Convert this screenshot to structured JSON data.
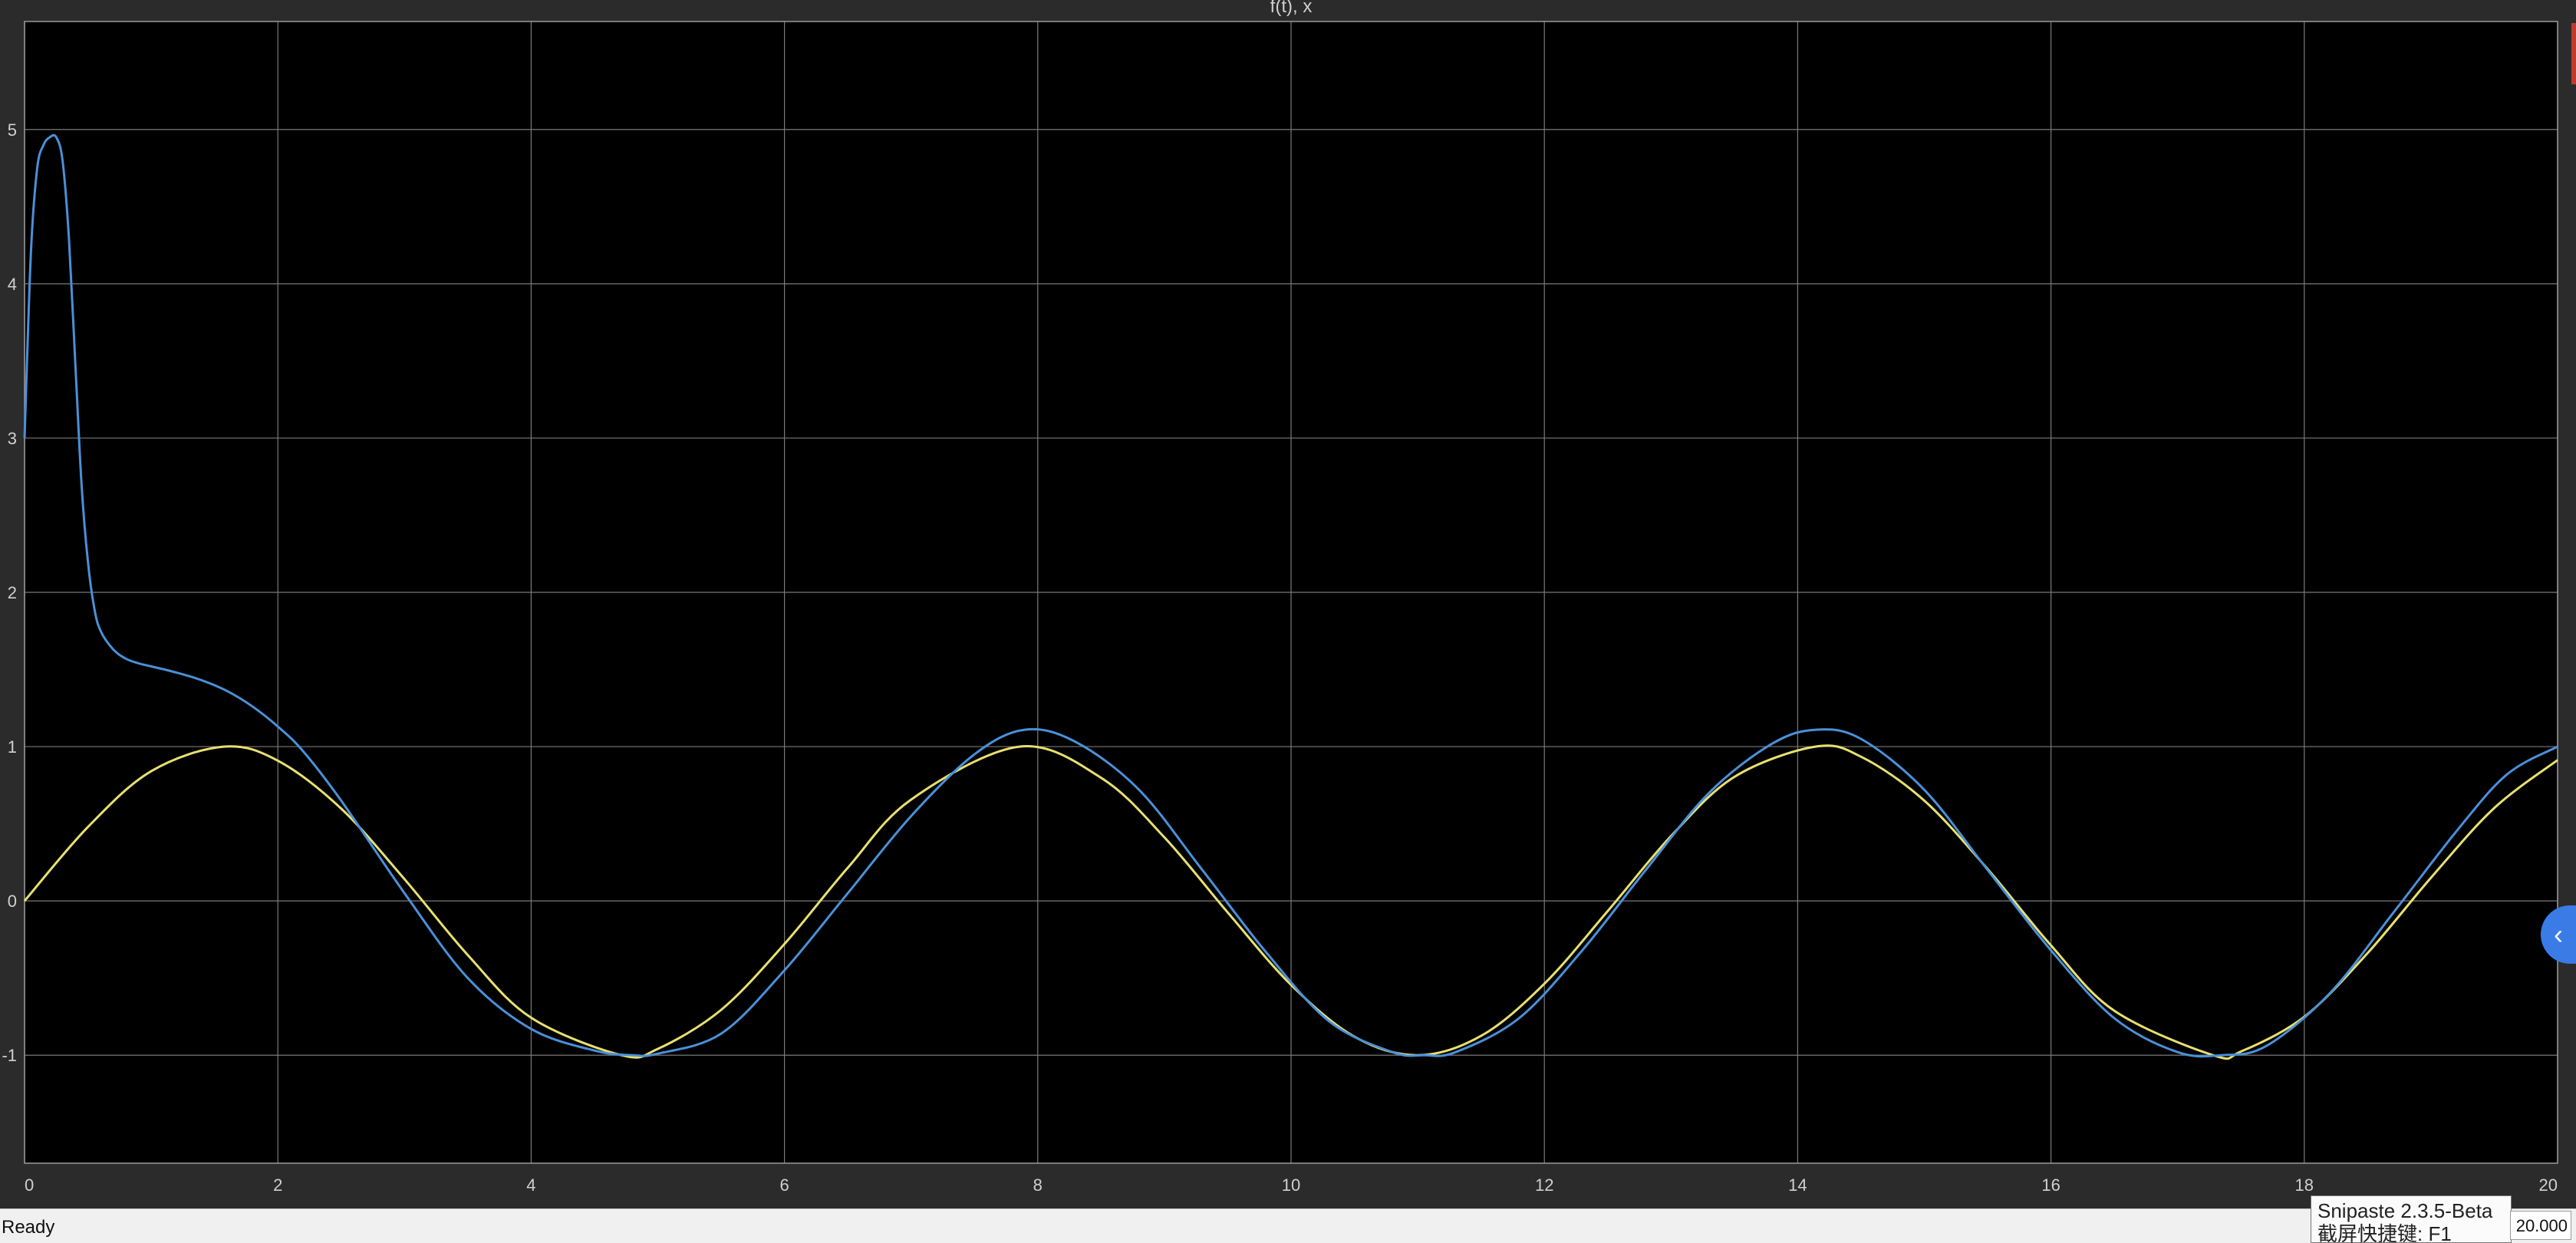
{
  "window": {
    "status": "Ready",
    "time_display": "20.000"
  },
  "tooltip": {
    "title": "Snipaste 2.3.5-Beta",
    "hint": "截屏快捷键: F1"
  },
  "collapse_icon": "chevron-left-icon",
  "colors": {
    "background": "#2b2b2b",
    "plot_background": "#000000",
    "grid": "#7a7a7a",
    "series_blue": "#4a90d9",
    "series_yellow": "#e8e070"
  },
  "chart_data": {
    "type": "line",
    "title": "f(t), x",
    "xlabel": "",
    "ylabel": "",
    "xlim": [
      0,
      20
    ],
    "ylim": [
      -1.7,
      5.7
    ],
    "xticks": [
      0,
      2,
      4,
      6,
      8,
      10,
      12,
      14,
      16,
      18,
      20
    ],
    "yticks": [
      -1,
      0,
      1,
      2,
      3,
      4,
      5
    ],
    "grid": true,
    "series": [
      {
        "color": "#4a90d9",
        "x": [
          0,
          0.05,
          0.1,
          0.15,
          0.2,
          0.25,
          0.3,
          0.35,
          0.4,
          0.45,
          0.5,
          0.55,
          0.6,
          0.7,
          0.8,
          0.9,
          1.0,
          1.2,
          1.4,
          1.6,
          1.8,
          2.0,
          2.2,
          2.5,
          3.0,
          3.5,
          4.0,
          4.5,
          4.8,
          5.0,
          5.5,
          6.0,
          6.5,
          7.0,
          7.5,
          7.9,
          8.3,
          8.8,
          9.3,
          9.8,
          10.3,
          10.8,
          11.05,
          11.3,
          11.8,
          12.3,
          12.8,
          13.3,
          13.8,
          14.15,
          14.5,
          15.0,
          15.5,
          16.0,
          16.5,
          17.0,
          17.35,
          17.7,
          18.2,
          18.7,
          19.2,
          19.6,
          20.0
        ],
        "y": [
          3.0,
          4.2,
          4.75,
          4.9,
          4.95,
          4.95,
          4.8,
          4.3,
          3.5,
          2.7,
          2.2,
          1.9,
          1.75,
          1.63,
          1.57,
          1.54,
          1.52,
          1.48,
          1.43,
          1.36,
          1.26,
          1.13,
          0.97,
          0.65,
          0.05,
          -0.5,
          -0.83,
          -0.97,
          -1.0,
          -0.99,
          -0.86,
          -0.45,
          0.05,
          0.55,
          0.95,
          1.11,
          1.03,
          0.72,
          0.2,
          -0.33,
          -0.78,
          -0.98,
          -1.0,
          -0.98,
          -0.76,
          -0.32,
          0.2,
          0.7,
          1.02,
          1.11,
          1.05,
          0.72,
          0.2,
          -0.32,
          -0.76,
          -0.98,
          -1.0,
          -0.94,
          -0.6,
          -0.08,
          0.45,
          0.82,
          1.0
        ]
      },
      {
        "color": "#e8e070",
        "x": [
          0,
          0.5,
          1.0,
          1.5708,
          2.0,
          2.5,
          3.0,
          3.5,
          4.0,
          4.7124,
          5.0,
          5.5,
          6.0,
          6.5,
          7.0,
          7.854,
          8.5,
          9.0,
          9.5,
          10.0,
          10.5,
          10.9956,
          11.5,
          12.0,
          12.5,
          13.0,
          13.5,
          14.1372,
          14.5,
          15.0,
          15.5,
          16.0,
          16.5,
          17.2788,
          17.5,
          18.0,
          18.5,
          19.0,
          19.5,
          20.0
        ],
        "y": [
          0,
          0.479,
          0.841,
          1.0,
          0.909,
          0.598,
          0.141,
          -0.351,
          -0.757,
          -1.0,
          -0.959,
          -0.706,
          -0.279,
          0.215,
          0.657,
          1.0,
          0.798,
          0.412,
          -0.075,
          -0.544,
          -0.88,
          -1.0,
          -0.875,
          -0.537,
          -0.066,
          0.42,
          0.804,
          1.0,
          0.935,
          0.65,
          0.206,
          -0.288,
          -0.712,
          -1.0,
          -0.976,
          -0.751,
          -0.338,
          0.15,
          0.602,
          0.913
        ]
      }
    ]
  }
}
